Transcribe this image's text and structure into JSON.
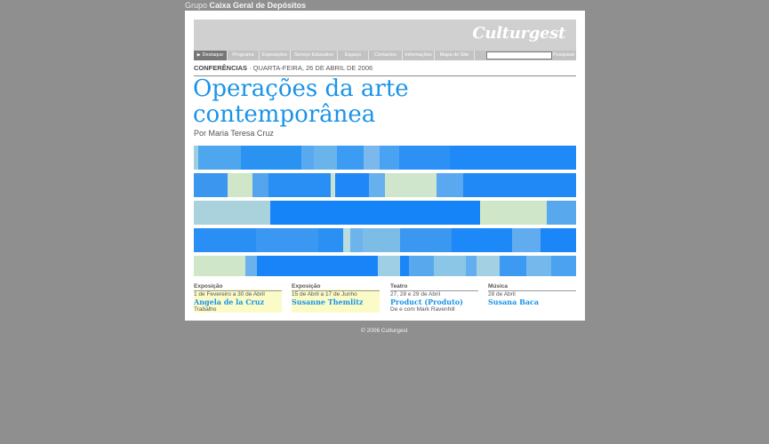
{
  "group": {
    "prefix": "Grupo",
    "name": "Caixa Geral de Depósitos"
  },
  "logo": "Culturgest",
  "nav": {
    "items": [
      {
        "label": "Destaque",
        "active": true
      },
      {
        "label": "Programa",
        "active": false
      },
      {
        "label": "Exposições",
        "active": false
      },
      {
        "label": "Serviço Educativo",
        "active": false
      },
      {
        "label": "Espaço",
        "active": false
      },
      {
        "label": "Contactos",
        "active": false
      },
      {
        "label": "Informações",
        "active": false
      },
      {
        "label": "Mapa do Site",
        "active": false
      }
    ],
    "search_value": "",
    "search_button": "Pesquisar"
  },
  "article": {
    "category": "CONFERÊNCIAS",
    "date": " · QUARTA-FEIRA, 26 DE ABRIL DE 2006",
    "title_line1": "Operações da arte",
    "title_line2": "contemporânea",
    "author": "Por Maria Teresa Cruz"
  },
  "colors": {
    "accent_blue": "#1a93e8",
    "page_bg": "#8f8f8f",
    "highlight": "#fbfbc8"
  },
  "events": [
    {
      "category": "Exposição",
      "date": "1 de Fevereiro a 30 de Abril",
      "title": "Angela de la Cruz",
      "subtitle": "Trabalho",
      "highlighted": true
    },
    {
      "category": "Exposição",
      "date": "15 de Abril a 17 de Junho",
      "title": "Susanne Themlitz",
      "subtitle": "",
      "highlighted": true
    },
    {
      "category": "Teatro",
      "date": "27, 28 e 29 de Abril",
      "title": "Product (Produto)",
      "subtitle": "De e com Mark Ravenhill",
      "highlighted": false
    },
    {
      "category": "Música",
      "date": "28 de Abril",
      "title": "Susana Baca",
      "subtitle": "",
      "highlighted": false
    }
  ],
  "footer": "© 2006 Culturgest"
}
